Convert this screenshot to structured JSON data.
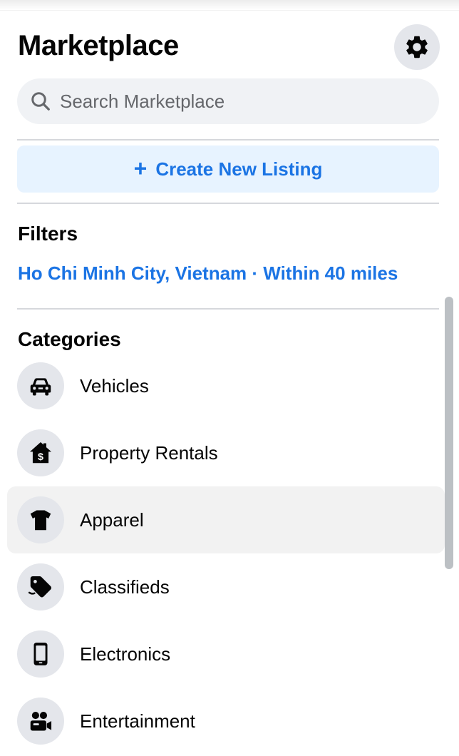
{
  "header": {
    "title": "Marketplace",
    "settings_icon": "gear-icon"
  },
  "search": {
    "placeholder": "Search Marketplace",
    "value": "",
    "icon": "search-icon"
  },
  "create_listing": {
    "label": "Create New Listing",
    "icon": "plus-icon"
  },
  "filters": {
    "title": "Filters",
    "value": "Ho Chi Minh City, Vietnam · Within 40 miles"
  },
  "categories": {
    "title": "Categories",
    "items": [
      {
        "label": "Vehicles",
        "icon": "car-icon",
        "active": false
      },
      {
        "label": "Property Rentals",
        "icon": "house-dollar-icon",
        "active": false
      },
      {
        "label": "Apparel",
        "icon": "shirt-icon",
        "active": true
      },
      {
        "label": "Classifieds",
        "icon": "tag-icon",
        "active": false
      },
      {
        "label": "Electronics",
        "icon": "phone-icon",
        "active": false
      },
      {
        "label": "Entertainment",
        "icon": "people-camera-icon",
        "active": false
      }
    ]
  },
  "colors": {
    "accent": "#1b74e4",
    "button_bg": "#e7f3ff",
    "icon_bg": "#e4e6eb",
    "active_row_bg": "#f2f2f2"
  }
}
